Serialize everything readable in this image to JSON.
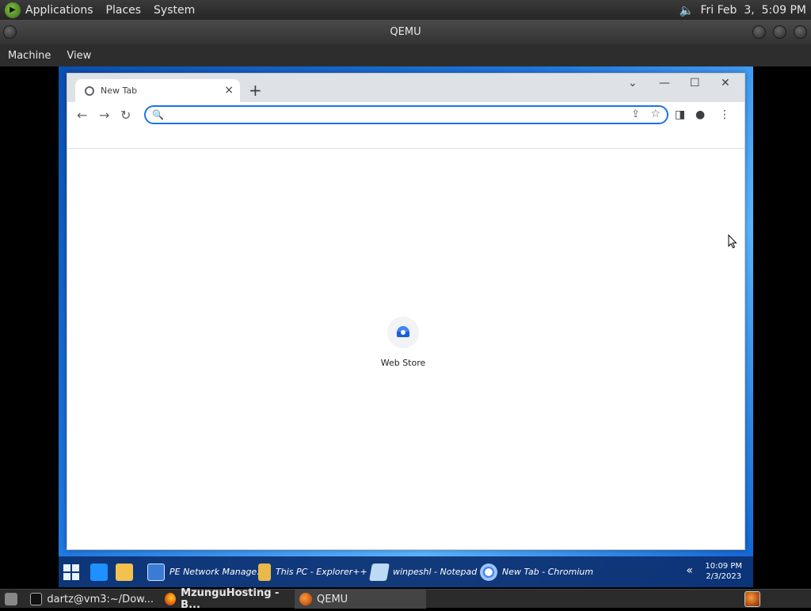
{
  "host_panel": {
    "menus": [
      "Applications",
      "Places",
      "System"
    ],
    "datetime": "Fri Feb  3,  5:09 PM"
  },
  "qemu": {
    "title": "QEMU",
    "menu": [
      "Machine",
      "View"
    ]
  },
  "browser": {
    "tab_title": "New Tab",
    "tab_close": "×",
    "new_tab": "+",
    "omnibox_value": "",
    "shortcut_tiles": [
      {
        "label": "Web Store"
      }
    ]
  },
  "guest_taskbar": {
    "items": [
      {
        "label": "PE Network Manage..."
      },
      {
        "label": "This PC - Explorer++"
      },
      {
        "label": "winpeshl - Notepad"
      },
      {
        "label": "New Tab - Chromium"
      }
    ],
    "time": "10:09 PM",
    "date": "2/3/2023"
  },
  "host_taskbar": {
    "items": [
      {
        "label": "dartz@vm3:~/Dow..."
      },
      {
        "label": "MzunguHosting - B..."
      },
      {
        "label": "QEMU"
      }
    ]
  },
  "colors": {
    "omnibox_focus": "#1a73e8",
    "guest_taskbar": "#0c3070"
  }
}
